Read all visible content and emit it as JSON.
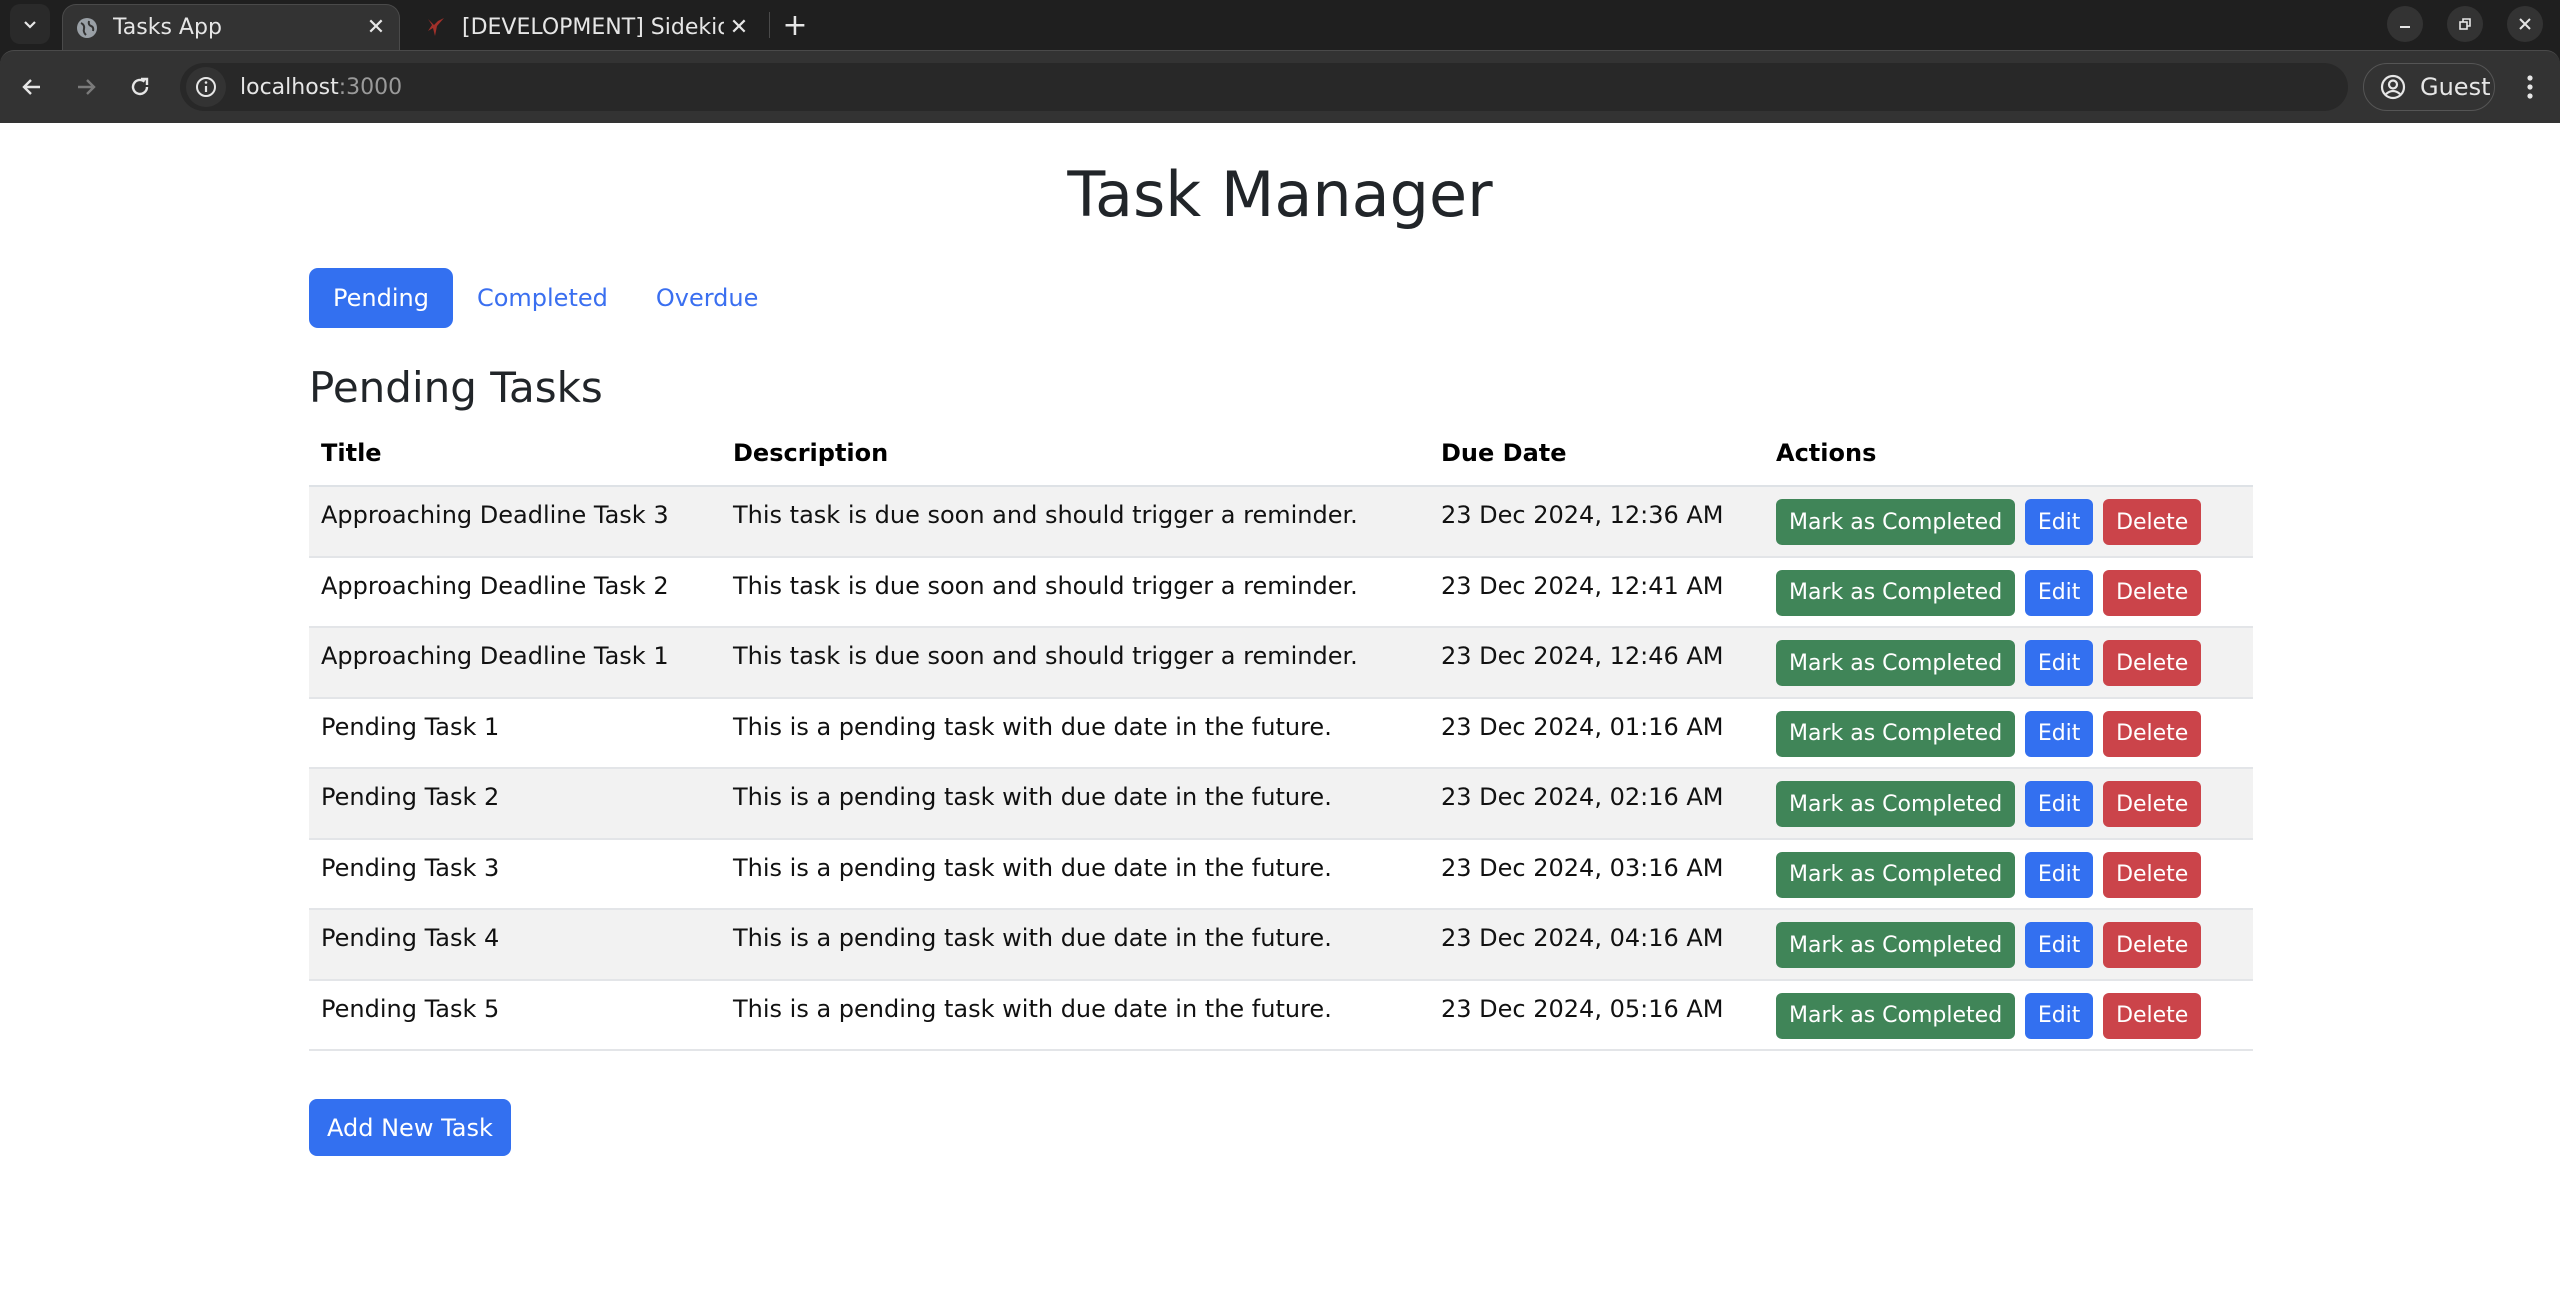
{
  "browser": {
    "tabs": [
      {
        "title": "Tasks App",
        "active": true,
        "favicon": "globe-icon"
      },
      {
        "title": "[DEVELOPMENT] Sidekiq",
        "active": false,
        "favicon": "sidekiq-icon"
      }
    ],
    "address": {
      "host": "localhost",
      "port": ":3000"
    },
    "profile_label": "Guest"
  },
  "header": {
    "title": "Task Manager"
  },
  "nav": {
    "tabs": [
      {
        "label": "Pending",
        "active": true
      },
      {
        "label": "Completed",
        "active": false
      },
      {
        "label": "Overdue",
        "active": false
      }
    ]
  },
  "section": {
    "title": "Pending Tasks"
  },
  "table": {
    "columns": [
      "Title",
      "Description",
      "Due Date",
      "Actions"
    ],
    "rows": [
      {
        "title": "Approaching Deadline Task 3",
        "description": "This task is due soon and should trigger a reminder.",
        "due": "23 Dec 2024, 12:36 AM"
      },
      {
        "title": "Approaching Deadline Task 2",
        "description": "This task is due soon and should trigger a reminder.",
        "due": "23 Dec 2024, 12:41 AM"
      },
      {
        "title": "Approaching Deadline Task 1",
        "description": "This task is due soon and should trigger a reminder.",
        "due": "23 Dec 2024, 12:46 AM"
      },
      {
        "title": "Pending Task 1",
        "description": "This is a pending task with due date in the future.",
        "due": "23 Dec 2024, 01:16 AM"
      },
      {
        "title": "Pending Task 2",
        "description": "This is a pending task with due date in the future.",
        "due": "23 Dec 2024, 02:16 AM"
      },
      {
        "title": "Pending Task 3",
        "description": "This is a pending task with due date in the future.",
        "due": "23 Dec 2024, 03:16 AM"
      },
      {
        "title": "Pending Task 4",
        "description": "This is a pending task with due date in the future.",
        "due": "23 Dec 2024, 04:16 AM"
      },
      {
        "title": "Pending Task 5",
        "description": "This is a pending task with due date in the future.",
        "due": "23 Dec 2024, 05:16 AM"
      }
    ],
    "actions": {
      "complete": "Mark as Completed",
      "edit": "Edit",
      "delete": "Delete"
    }
  },
  "footer": {
    "add_label": "Add New Task"
  },
  "colors": {
    "primary": "#3370f0",
    "success": "#408558",
    "danger": "#cb444a"
  }
}
